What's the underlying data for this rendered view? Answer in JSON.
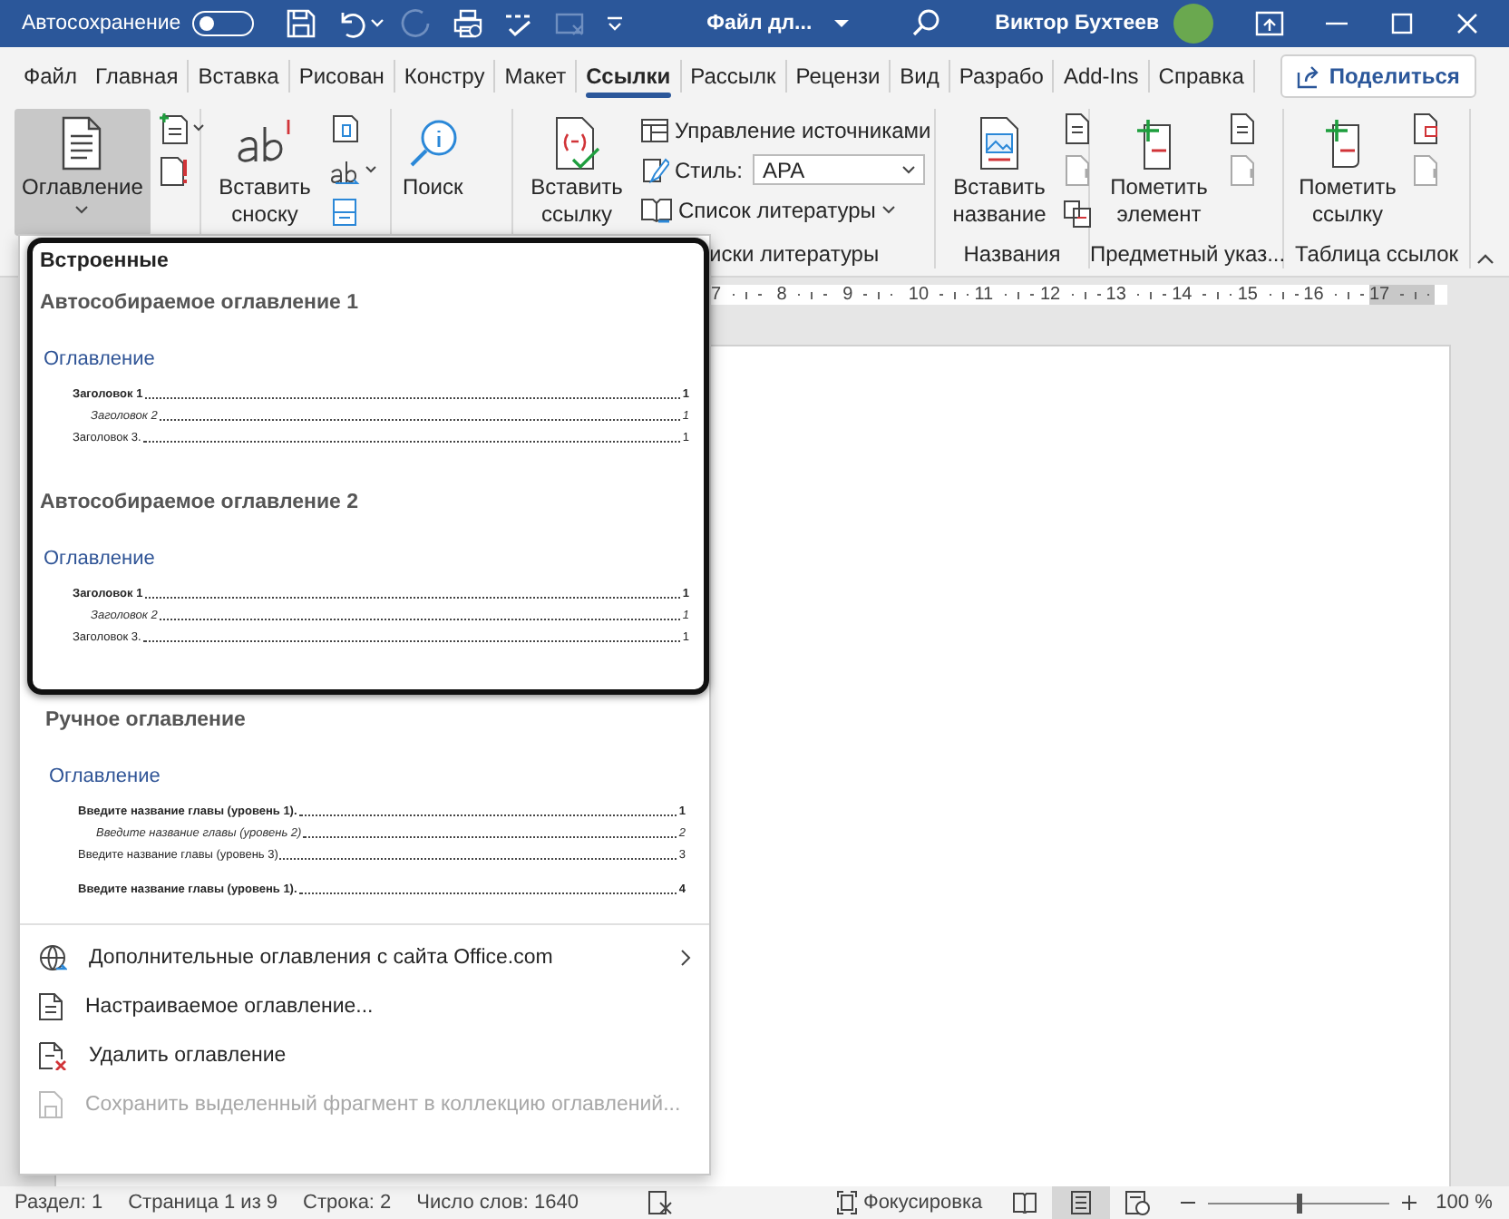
{
  "title_bar": {
    "autosave_label": "Автосохранение",
    "autosave_on": false,
    "document_title": "Файл дл...",
    "user_name": "Виктор Бухтеев"
  },
  "tabs": [
    {
      "label": "Файл",
      "selected": false
    },
    {
      "label": "Главная",
      "selected": false
    },
    {
      "label": "Вставка",
      "selected": false
    },
    {
      "label": "Рисован",
      "selected": false
    },
    {
      "label": "Констру",
      "selected": false
    },
    {
      "label": "Макет",
      "selected": false
    },
    {
      "label": "Ссылки",
      "selected": true
    },
    {
      "label": "Рассылк",
      "selected": false
    },
    {
      "label": "Рецензи",
      "selected": false
    },
    {
      "label": "Вид",
      "selected": false
    },
    {
      "label": "Разрабо",
      "selected": false
    },
    {
      "label": "Add-Ins",
      "selected": false
    },
    {
      "label": "Справка",
      "selected": false
    }
  ],
  "share_button": "Поделиться",
  "ribbon": {
    "toc_button": {
      "label": "Оглавление",
      "expanded": true
    },
    "footnote_button": "Вставить сноску",
    "search_button": "Поиск",
    "citation_button": "Вставить ссылку",
    "manage_sources": "Управление источниками",
    "style_label": "Стиль:",
    "style_value": "APA",
    "bibliography": "Список литературы",
    "caption_button": "Вставить название",
    "mark_entry_button": "Пометить элемент",
    "mark_citation_button": "Пометить ссылку",
    "group_labels": [
      "иски литературы",
      "Названия",
      "Предметный указ...",
      "Таблица ссылок"
    ]
  },
  "ruler": {
    "numbers": [
      "7",
      "8",
      "9",
      "10",
      "11",
      "12",
      "13",
      "14",
      "15",
      "16",
      "17"
    ]
  },
  "toc_menu": {
    "builtin_header": "Встроенные",
    "builtin_highlighted": true,
    "options": [
      {
        "title": "Автособираемое оглавление 1",
        "heading": "Оглавление",
        "entries": [
          {
            "text": "Заголовок 1",
            "page": "1",
            "kind": "bold"
          },
          {
            "text": "Заголовок 2",
            "page": "1",
            "kind": "italic"
          },
          {
            "text": "Заголовок 3.",
            "page": "1",
            "kind": "regular"
          }
        ]
      },
      {
        "title": "Автособираемое оглавление 2",
        "heading": "Оглавление",
        "entries": [
          {
            "text": "Заголовок 1",
            "page": "1",
            "kind": "bold"
          },
          {
            "text": "Заголовок 2",
            "page": "1",
            "kind": "italic"
          },
          {
            "text": "Заголовок 3.",
            "page": "1",
            "kind": "regular"
          }
        ]
      },
      {
        "title": "Ручное оглавление",
        "heading": "Оглавление",
        "entries": [
          {
            "text": "Введите название главы (уровень 1).",
            "page": "1",
            "kind": "bold"
          },
          {
            "text": "Введите название главы (уровень 2)",
            "page": "2",
            "kind": "italic"
          },
          {
            "text": "Введите название главы (уровень 3)",
            "page": "3",
            "kind": "regular"
          },
          {
            "text": "Введите название главы (уровень 1).",
            "page": "4",
            "kind": "bold"
          }
        ]
      }
    ],
    "items": [
      {
        "label": "Дополнительные оглавления с сайта Office.com",
        "submenu": true,
        "disabled": false
      },
      {
        "label": "Настраиваемое оглавление...",
        "submenu": false,
        "disabled": false
      },
      {
        "label": "Удалить оглавление",
        "submenu": false,
        "disabled": false
      },
      {
        "label": "Сохранить выделенный фрагмент в коллекцию оглавлений...",
        "submenu": false,
        "disabled": true
      }
    ]
  },
  "status_bar": {
    "items": [
      "Раздел: 1",
      "Страница 1 из 9",
      "Строка: 2",
      "Число слов: 1640"
    ],
    "focus": "Фокусировка",
    "views": [
      {
        "selected": false
      },
      {
        "selected": true
      },
      {
        "selected": false
      }
    ],
    "zoom": {
      "level": 0.5
    },
    "zoom_label": "100 %"
  }
}
